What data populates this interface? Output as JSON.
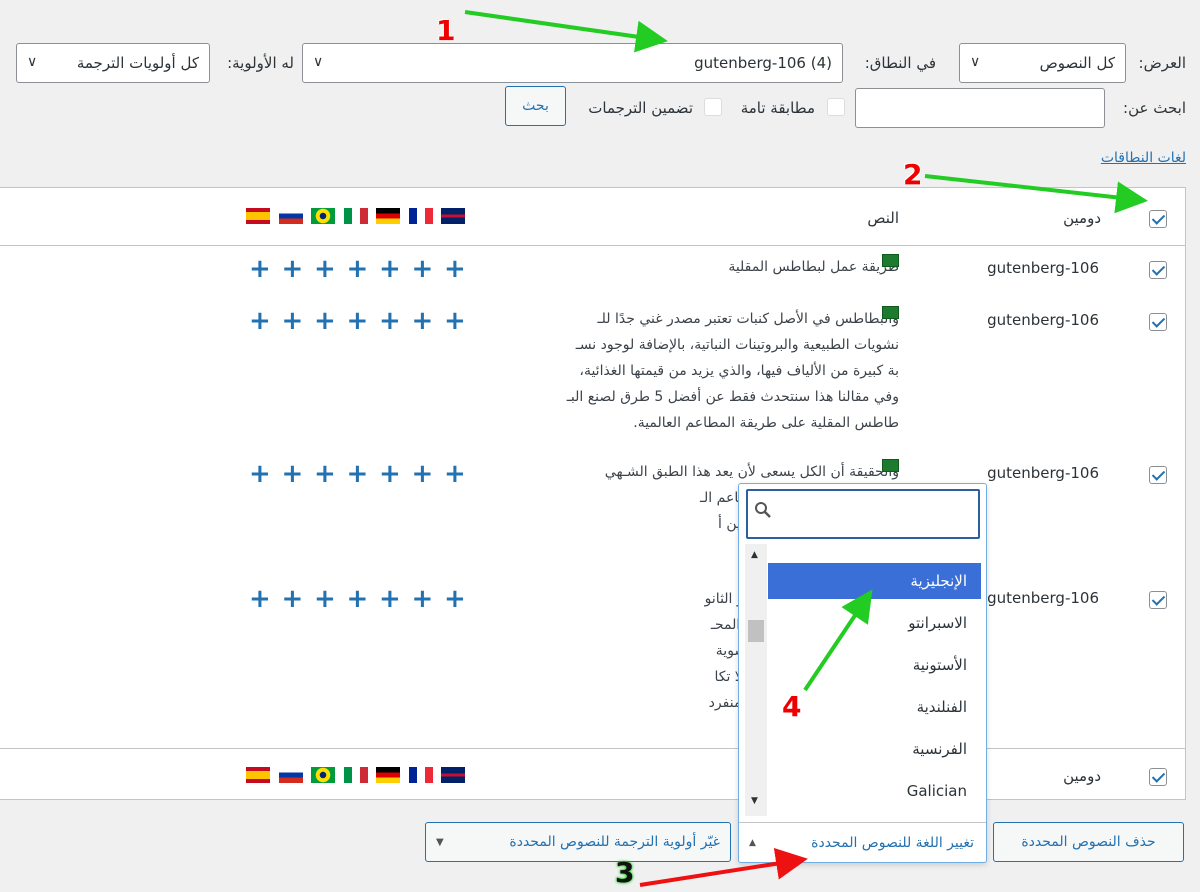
{
  "filters": {
    "view_label": "العرض:",
    "view_value": "كل النصوص",
    "scope_label": "في النطاق:",
    "scope_value": "gutenberg-106 (4)",
    "priority_label": "له الأولوية:",
    "priority_value": "كل أولويات الترجمة",
    "search_label": "ابحث عن:",
    "search_value": "",
    "exact_match": "مطابقة تامة",
    "include_translations": "تضمين الترجمات",
    "search_button": "بحث",
    "scope_languages_link": "لغات النطاقات"
  },
  "table": {
    "col_domain": "دومين",
    "col_text": "النص",
    "flags": [
      "es",
      "ru",
      "br",
      "it",
      "de",
      "fr",
      "gb"
    ],
    "rows": [
      {
        "domain": "gutenberg-106",
        "lines": [
          "طريقة عمل لبطاطس المقلية"
        ]
      },
      {
        "domain": "gutenberg-106",
        "lines": [
          "والبطاطس في الأصل كنبات تعتبر مصدر غني جدًا للـ",
          "نشويات الطبيعية والبروتينات النباتية، بالإضافة لوجود نسـ",
          "بة كبيرة من الألياف فيها، والذي يزيد من قيمتها الغذائية،",
          "وفي مقالنا هذا سنتحدث فقط عن أفضل 5 طرق لصنع البـ",
          "طاطس المقلية على طريقة المطاعم العالمية."
        ]
      },
      {
        "domain": "gutenberg-106",
        "lines": [
          "والحقيقة أن الكل يسعى لأن يعد هذا الطبق الشـهي",
          "لك الطرق التي تقدمها المطاعم الـ",
          "على شرائها الآلاف بل الملايين أ"
        ]
      },
      {
        "domain": "gutenberg-106",
        "lines": [
          "حمرة من الأطباق الجانبية أو الثانو",
          "تناولها مثلًا إلى جوار الفراخ المحـ",
          "بجانب اللحوم أو الكبدة المشوية",
          "جوار الأسماك والبحريات، فلا تكا",
          "لى جانب أن البعض يتناولها منفرد"
        ]
      }
    ]
  },
  "dropdown": {
    "search_placeholder": "",
    "options": [
      "الإنجليزية",
      "الاسبرانتو",
      "الأستونية",
      "الفنلندية",
      "الفرنسية",
      "Galician"
    ],
    "selected": "الإنجليزية"
  },
  "actions": {
    "delete": "حذف النصوص المحددة",
    "change_language": "تغيير اللغة للنصوص المحددة",
    "change_priority": "غيّر أولوية الترجمة للنصوص المحددة"
  },
  "annotations": [
    "1",
    "2",
    "3",
    "4"
  ],
  "colors": {
    "accent": "#2271b1",
    "highlight": "#3a6fd8",
    "arrow_green": "#22cc22",
    "arrow_red": "#ee1111"
  }
}
